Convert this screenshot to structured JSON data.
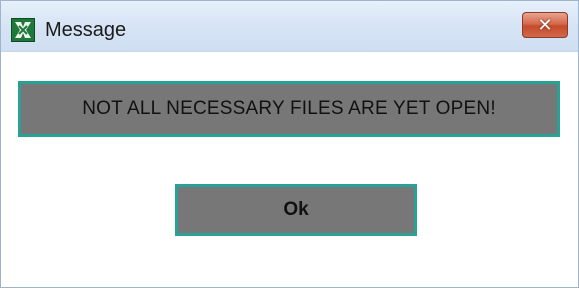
{
  "window": {
    "title": "Message",
    "close_label": "✕"
  },
  "message": {
    "text": "NOT ALL NECESSARY FILES ARE YET OPEN!"
  },
  "ok_button": {
    "label": "Ok"
  },
  "icons": {
    "app": "app-logo-icon",
    "close": "close-icon"
  },
  "colors": {
    "accent_border": "#2aa197",
    "panel_bg": "#777777",
    "titlebar_bg": "#d6e4f5",
    "close_bg": "#c44b2b"
  }
}
